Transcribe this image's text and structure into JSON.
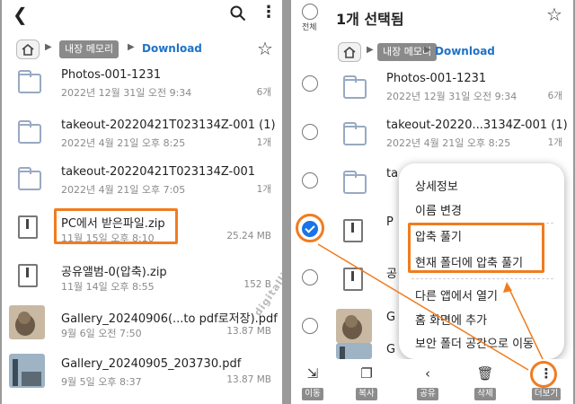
{
  "left": {
    "breadcrumb": {
      "storage": "내장 메모리",
      "current": "Download"
    },
    "files": [
      {
        "name": "Photos-001-1231",
        "date": "2022년 12월 31일 오전 9:34",
        "meta": "6개",
        "type": "folder"
      },
      {
        "name": "takeout-20220421T023134Z-001 (1)",
        "date": "2022년 4월 21일 오후 8:25",
        "meta": "1개",
        "type": "folder"
      },
      {
        "name": "takeout-20220421T023134Z-001",
        "date": "2022년 4월 21일 오후 7:05",
        "meta": "1개",
        "type": "folder"
      },
      {
        "name": "PC에서 받은파일.zip",
        "date": "11월 15일 오후 8:10",
        "meta": "25.24 MB",
        "type": "zip"
      },
      {
        "name": "공유앨범-0(압축).zip",
        "date": "11월 14일 오후 8:55",
        "meta": "152 B",
        "type": "zip"
      },
      {
        "name": "Gallery_20240906(...to pdf로저장).pdf",
        "date": "9월 6일 오전 7:50",
        "meta": "13.87 MB",
        "type": "pdf"
      },
      {
        "name": "Gallery_20240905_203730.pdf",
        "date": "9월 5일 오후 8:37",
        "meta": "13.87 MB",
        "type": "pdf"
      }
    ]
  },
  "right": {
    "title": "1개 선택됨",
    "select_all_label": "전체",
    "breadcrumb": {
      "storage": "내장 메모리",
      "current": "Download"
    },
    "files": [
      {
        "name": "Photos-001-1231",
        "date": "2022년 12월 31일 오전 9:34",
        "meta": "6개"
      },
      {
        "name": "takeout-20220...3134Z-001 (1)",
        "date": "2022년 4월 21일 오후 8:25",
        "meta": "1개"
      },
      {
        "name": "ta"
      },
      {
        "name": "P"
      },
      {
        "name": "공"
      },
      {
        "name": "G"
      },
      {
        "name": "G"
      }
    ],
    "context_menu": {
      "items": [
        "상세정보",
        "이름 변경",
        "압축 풀기",
        "현재 폴더에 압축 풀기",
        "다른 앱에서 열기",
        "홈 화면에 추가",
        "보안 폴더 공간으로 이동"
      ]
    },
    "bottom_bar": [
      {
        "label": "이동",
        "icon": "move-icon"
      },
      {
        "label": "복사",
        "icon": "copy-icon"
      },
      {
        "label": "공유",
        "icon": "share-icon"
      },
      {
        "label": "삭제",
        "icon": "delete-icon"
      },
      {
        "label": "더보기",
        "icon": "more-icon"
      }
    ]
  },
  "watermark": "digitalline",
  "colors": {
    "accent": "#1e72c8",
    "highlight": "#f07c1f",
    "checkbox": "#1a73e8"
  }
}
